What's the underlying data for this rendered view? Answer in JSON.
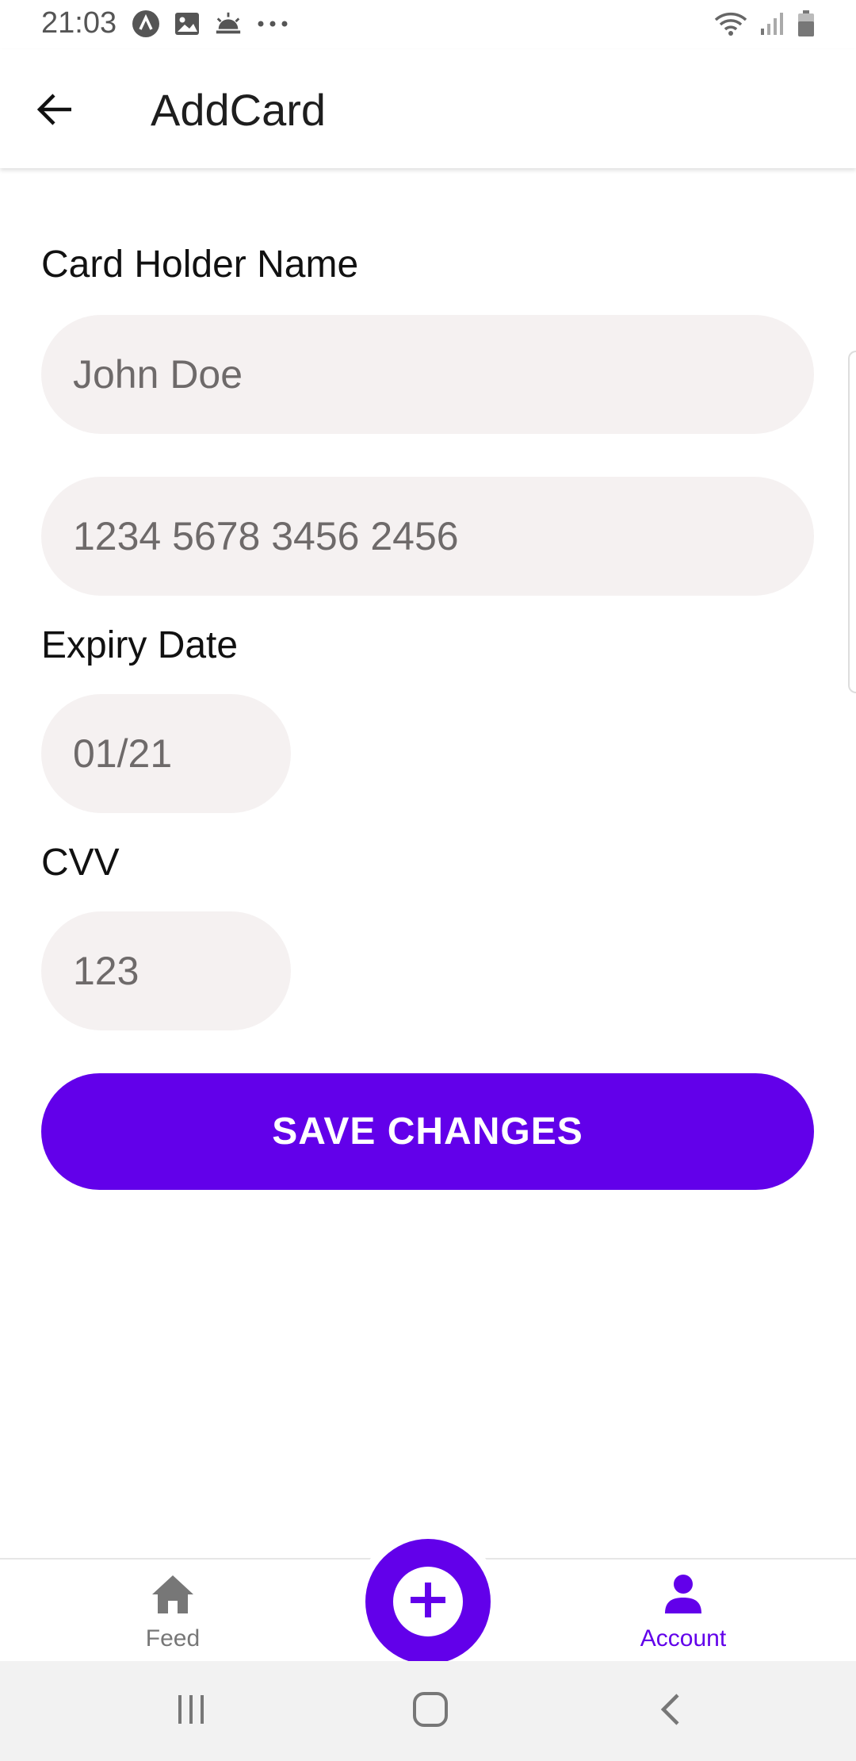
{
  "status_bar": {
    "time": "21:03",
    "left_icons": [
      "nav-arrow-icon",
      "image-icon",
      "weather-icon",
      "more-dots-icon"
    ],
    "right_icons": [
      "wifi-icon",
      "signal-icon",
      "battery-icon"
    ]
  },
  "app_bar": {
    "title": "AddCard",
    "back_icon": "arrow-back-icon"
  },
  "form": {
    "card_holder_label": "Card Holder Name",
    "card_holder_placeholder": "John Doe",
    "card_number_placeholder": "1234 5678 3456 2456",
    "expiry_label": "Expiry Date",
    "expiry_placeholder": "01/21",
    "cvv_label": "CVV",
    "cvv_placeholder": "123"
  },
  "save_button": {
    "label": "SAVE CHANGES"
  },
  "bottom_nav": {
    "items": [
      {
        "label": "Feed",
        "icon": "home-icon",
        "active": false
      },
      {
        "label": "Account",
        "icon": "person-icon",
        "active": true
      }
    ],
    "fab_icon": "plus-icon"
  },
  "colors": {
    "accent": "#6200ea",
    "field_background": "#f5f1f1",
    "system_nav": "#f2f2f2"
  },
  "system_nav": {
    "buttons": [
      "recents-icon",
      "home-circle-icon",
      "back-chevron-icon"
    ]
  }
}
